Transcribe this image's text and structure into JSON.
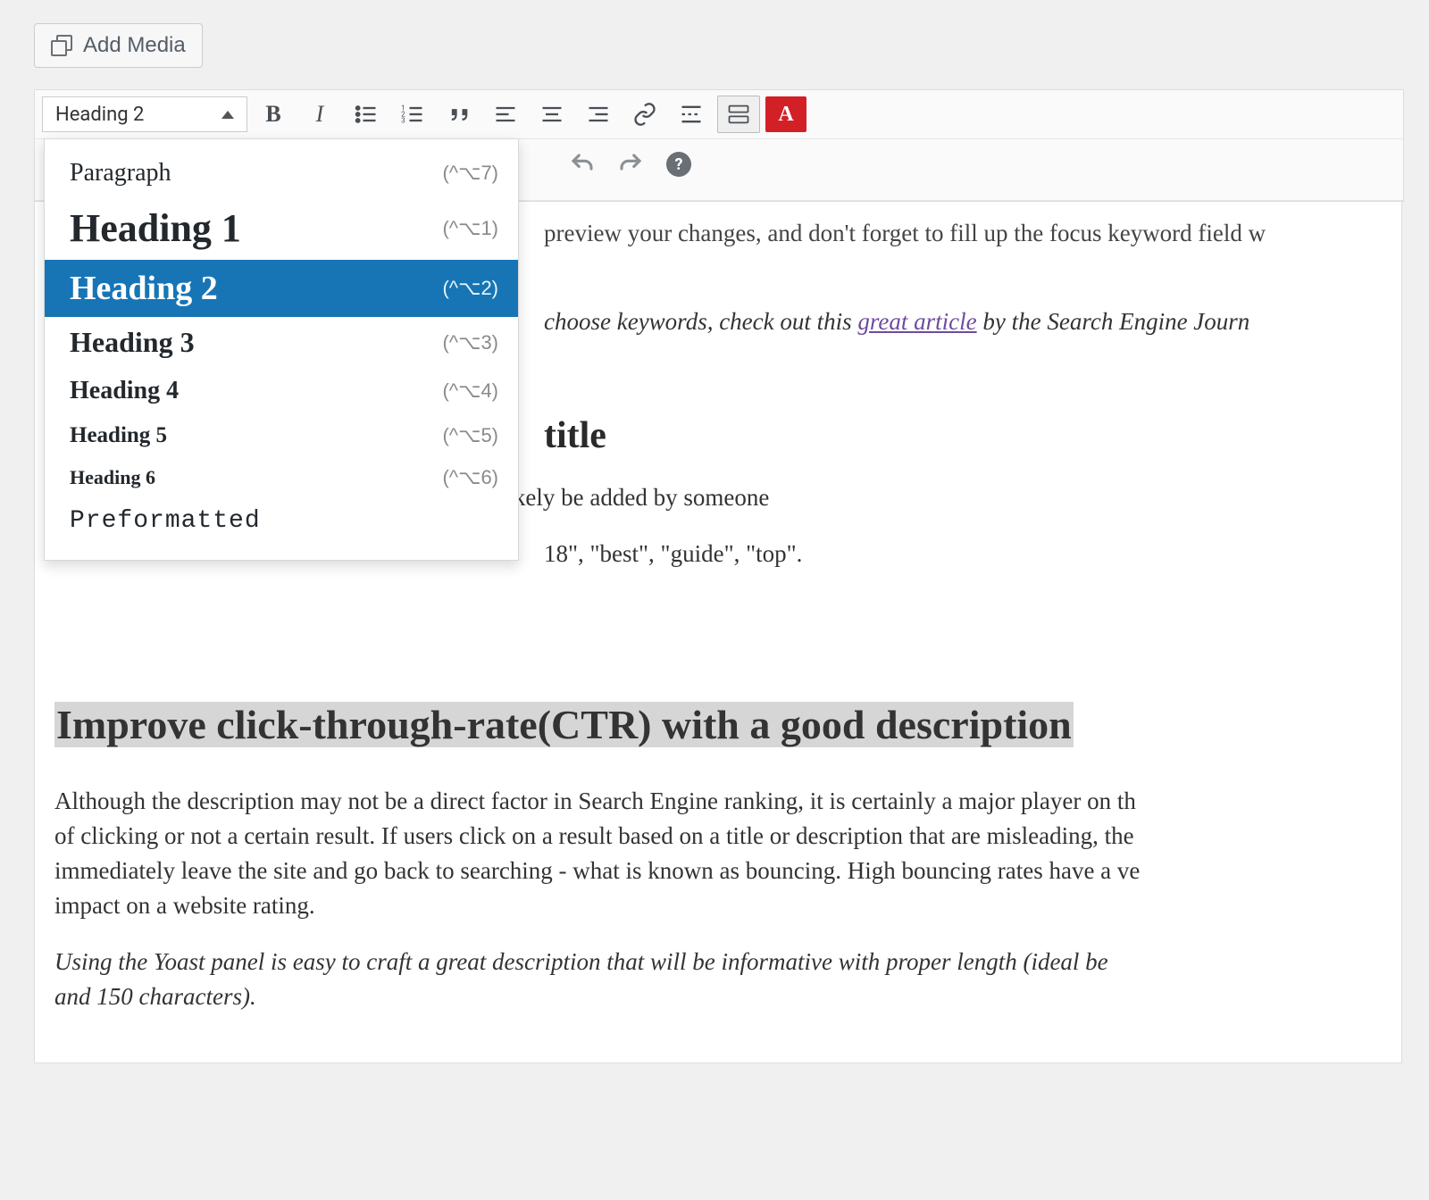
{
  "buttons": {
    "add_media": "Add Media"
  },
  "toolbar": {
    "format_selector_value": "Heading 2",
    "icons": {
      "bold": "B",
      "italic": "I",
      "text_color": "A"
    },
    "help_glyph": "?"
  },
  "format_dropdown": {
    "items": [
      {
        "label": "Paragraph",
        "shortcut": "(^⌥7)",
        "kind": "paragraph",
        "selected": false
      },
      {
        "label": "Heading 1",
        "shortcut": "(^⌥1)",
        "kind": "h1",
        "selected": false
      },
      {
        "label": "Heading 2",
        "shortcut": "(^⌥2)",
        "kind": "h2",
        "selected": true
      },
      {
        "label": "Heading 3",
        "shortcut": "(^⌥3)",
        "kind": "h3",
        "selected": false
      },
      {
        "label": "Heading 4",
        "shortcut": "(^⌥4)",
        "kind": "h4",
        "selected": false
      },
      {
        "label": "Heading 5",
        "shortcut": "(^⌥5)",
        "kind": "h5",
        "selected": false
      },
      {
        "label": "Heading 6",
        "shortcut": "(^⌥6)",
        "kind": "h6",
        "selected": false
      },
      {
        "label": "Preformatted",
        "shortcut": "",
        "kind": "pre",
        "selected": false
      }
    ]
  },
  "content": {
    "cut_line_1": "preview your changes, and don't forget to fill up the focus keyword field w",
    "italic_pre_link": "choose keywords, check out this ",
    "link_text": "great article",
    "italic_post_link": " by the Search Engine Journ",
    "peek_heading": "title",
    "peek_line_1": "h long tail keywords. They are terms that will likely be added by someone",
    "peek_line_2": "18\", \"best\", \"guide\", \"top\".",
    "selected_h2": "Improve click-through-rate(CTR) with a good description",
    "body_para_1": "Although the description may not be a direct factor in Search Engine ranking, it is certainly a major player on th",
    "body_para_2": "of clicking or not a certain result. If users click on a result based on a title or description that are misleading, the",
    "body_para_3": "immediately leave the site and go back to searching - what is known as bouncing. High bouncing rates have a ve",
    "body_para_4": "impact on a website rating.",
    "italic_body_1": "Using the Yoast panel is easy to craft a great description that will be informative with proper length (ideal be",
    "italic_body_2": "and 150 characters)."
  }
}
